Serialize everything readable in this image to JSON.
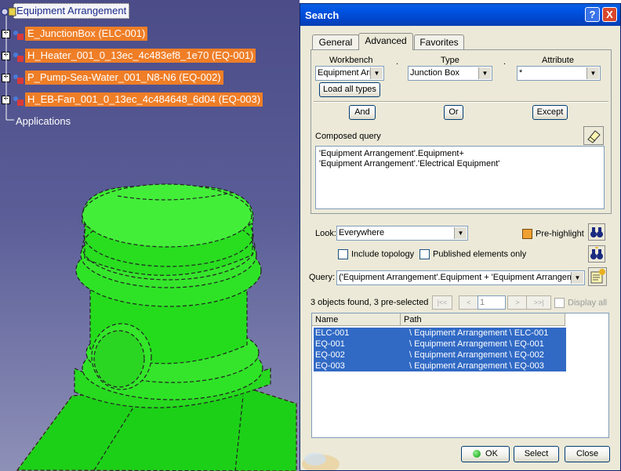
{
  "tree": {
    "root": "Equipment Arrangement",
    "items": [
      "E_JunctionBox (ELC-001)",
      "H_Heater_001_0_13ec_4c483ef8_1e70 (EQ-001)",
      "P_Pump-Sea-Water_001_N8-N6 (EQ-002)",
      "H_EB-Fan_001_0_13ec_4c484648_6d04 (EQ-003)"
    ],
    "applications": "Applications"
  },
  "dialog": {
    "title": "Search",
    "help": "?",
    "close": "X",
    "tabs": [
      "General",
      "Advanced",
      "Favorites"
    ],
    "workbench_label": "Workbench",
    "type_label": "Type",
    "attribute_label": "Attribute",
    "dot": ".",
    "workbench_value": "Equipment Arr",
    "type_value": "Junction Box",
    "attribute_value": "*",
    "load_all_types": "Load all types",
    "and": "And",
    "or": "Or",
    "except": "Except",
    "composed_query_label": "Composed query",
    "composed_query_lines": [
      "'Equipment Arrangement'.Equipment+",
      "'Equipment Arrangement'.'Electrical Equipment'"
    ],
    "look_label": "Look:",
    "look_value": "Everywhere",
    "pre_highlight": "Pre-highlight",
    "include_topology": "Include topology",
    "published_only": "Published elements only",
    "query_label": "Query:",
    "query_value": "('Equipment Arrangement'.Equipment + 'Equipment Arrangeme",
    "found_text": "3 objects found, 3 pre-selected",
    "page_value": "1",
    "display_all": "Display all",
    "columns": [
      "Name",
      "Path"
    ],
    "rows": [
      [
        "ELC-001",
        "\\ Equipment Arrangement \\ ELC-001"
      ],
      [
        "EQ-001",
        "\\ Equipment Arrangement \\ EQ-001"
      ],
      [
        "EQ-002",
        "\\ Equipment Arrangement \\ EQ-002"
      ],
      [
        "EQ-003",
        "\\ Equipment Arrangement \\ EQ-003"
      ]
    ],
    "ok": "OK",
    "select": "Select",
    "close_btn": "Close"
  },
  "colors": {
    "highlight": "#ef7e27",
    "part_green": "#22e01e",
    "selection_blue": "#316ac5"
  }
}
